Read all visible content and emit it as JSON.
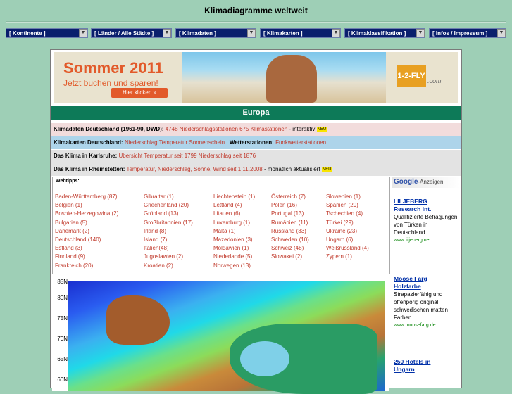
{
  "page_title": "Klimadiagramme weltweit",
  "nav": [
    {
      "label": "[ Kontinente ]"
    },
    {
      "label": "[ Länder / Alle Städte ]"
    },
    {
      "label": "[ Klimadaten ]"
    },
    {
      "label": "[ Klimakarten ]"
    },
    {
      "label": "[ Klimaklassifikation ]"
    },
    {
      "label": "[ Infos / Impressum ]"
    }
  ],
  "banner": {
    "headline": "Sommer 2011",
    "sub": "Jetzt buchen und sparen!",
    "button": "Hier klicken »",
    "logo": "1-2-FLY",
    "logo_domain": ".com"
  },
  "section_title": "Europa",
  "rows": {
    "r1": {
      "label": "Klimadaten Deutschland (1961-90, DWD):",
      "link1": "4748 Niederschlagsstationen",
      "link2": "675 Klimastationen",
      "suffix": "- interaktiv",
      "badge": "NEU"
    },
    "r2": {
      "label": "Klimakarten Deutschland:",
      "link1": "Niederschlag",
      "link2": "Temperatur",
      "link3": "Sonnenschein",
      "sep": "|",
      "label2": "Wetterstationen:",
      "link4": "Funkwetterstationen"
    },
    "r3": {
      "label": "Das Klima in Karlsruhe:",
      "link1": "Übersicht",
      "link2": "Temperatur seit 1799",
      "link3": "Niederschlag seit 1876"
    },
    "r4": {
      "label": "Das Klima in Rheinstetten:",
      "link1": "Temperatur, Niederschlag, Sonne, Wind seit 1.11.2008",
      "suffix": "- monatlich aktualisiert",
      "badge": "NEU"
    }
  },
  "webtips_label": "Webtipps:",
  "countries": [
    [
      "Baden-Württemberg (87)",
      "Belgien (1)",
      "Bosnien-Herzegowina (2)",
      "Bulgarien (5)",
      "Dänemark (2)",
      "Deutschland (140)",
      "Estland (3)",
      "Finnland (9)",
      "Frankreich (20)"
    ],
    [
      "Gibraltar (1)",
      "Griechenland (20)",
      "Grönland (13)",
      "Großbritannien (17)",
      "Irland (8)",
      "Island (7)",
      "Italien(48)",
      "Jugoslawien (2)",
      "Kroatien (2)"
    ],
    [
      "Liechtenstein (1)",
      "Lettland (4)",
      "Litauen (6)",
      "Luxemburg (1)",
      "Malta (1)",
      "Mazedonien (3)",
      "Moldawien (1)",
      "Niederlande (5)",
      "Norwegen (13)"
    ],
    [
      "Österreich (7)",
      "Polen (16)",
      "Portugal (13)",
      "Rumänien (11)",
      "Russland (33)",
      "Schweden (10)",
      "Schweiz (48)",
      "Slowakei (2)"
    ],
    [
      "Slowenien (1)",
      "Spanien (29)",
      "Tschechien (4)",
      "Türkei (29)",
      "Ukraine (23)",
      "Ungarn (6)",
      "Weißrussland (4)",
      "Zypern (1)"
    ]
  ],
  "map_ticks": [
    "85N",
    "80N",
    "75N",
    "70N",
    "65N",
    "60N"
  ],
  "ads": {
    "header_brand": "Google",
    "header_text": "-Anzeigen",
    "items": [
      {
        "title1": "LILJEBERG",
        "title2": "Research Int.",
        "body": "Qualifizierte Befragungen von Türken in Deutschland",
        "url": "www.liljeberg.net"
      },
      {
        "title1": "Moose Färg",
        "title2": "Holzfarbe",
        "body": "Strapazierfähig und offenporig original schwedischen matten Farben",
        "url": "www.moosefarg.de"
      },
      {
        "title1": "250 Hotels in",
        "title2": "Ungarn",
        "body": "",
        "url": ""
      }
    ]
  }
}
